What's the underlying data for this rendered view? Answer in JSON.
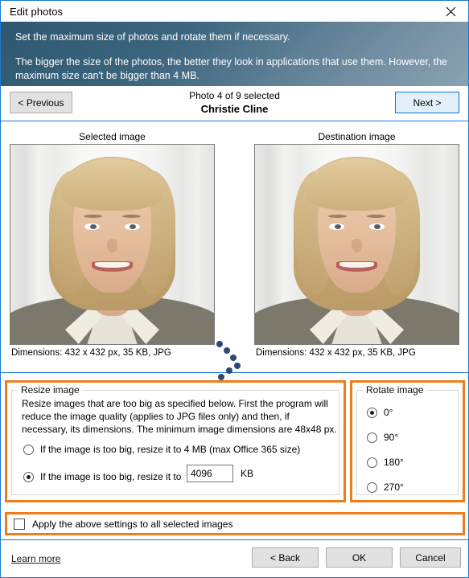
{
  "window": {
    "title": "Edit photos",
    "close_icon": "close-icon"
  },
  "header": {
    "line1": "Set the maximum size of photos and rotate them if necessary.",
    "line2": "The bigger the size of the photos, the better they look in applications that use them. However, the maximum size can't be bigger than 4 MB."
  },
  "nav": {
    "previous_label": "< Previous",
    "next_label": "Next >",
    "counter": "Photo 4 of 9 selected",
    "person_name": "Christie Cline"
  },
  "compare": {
    "selected_caption": "Selected image",
    "destination_caption": "Destination image",
    "selected_dimensions": "Dimensions: 432 x 432 px, 35 KB, JPG",
    "destination_dimensions": "Dimensions: 432 x 432 px, 35 KB, JPG",
    "arrow_icon": "dotted-chevron-right-icon"
  },
  "resize": {
    "group_title": "Resize image",
    "description": "Resize images that are too big as specified below. First the program will reduce the image quality (applies to JPG files only) and then, if necessary, its dimensions. The minimum image dimensions are 48x48 px.",
    "option_office365": "If the image is too big, resize it to 4 MB (max Office 365 size)",
    "option_custom": "If the image is too big, resize it to",
    "custom_value": "4096",
    "custom_unit": "KB",
    "selected_option": "custom"
  },
  "rotate": {
    "group_title": "Rotate image",
    "options": [
      "0°",
      "90°",
      "180°",
      "270°"
    ],
    "selected_index": 0
  },
  "apply_all": {
    "label": "Apply the above settings to all selected images",
    "checked": false
  },
  "footer": {
    "learn_more": "Learn more",
    "back_label": "< Back",
    "ok_label": "OK",
    "cancel_label": "Cancel"
  },
  "colors": {
    "accent_blue": "#1a7ad4",
    "highlight_orange": "#ef7d1a",
    "header_gradient_start": "#2e5770",
    "header_gradient_end": "#8ba3b3",
    "chevron_dot": "#2b4a77"
  }
}
